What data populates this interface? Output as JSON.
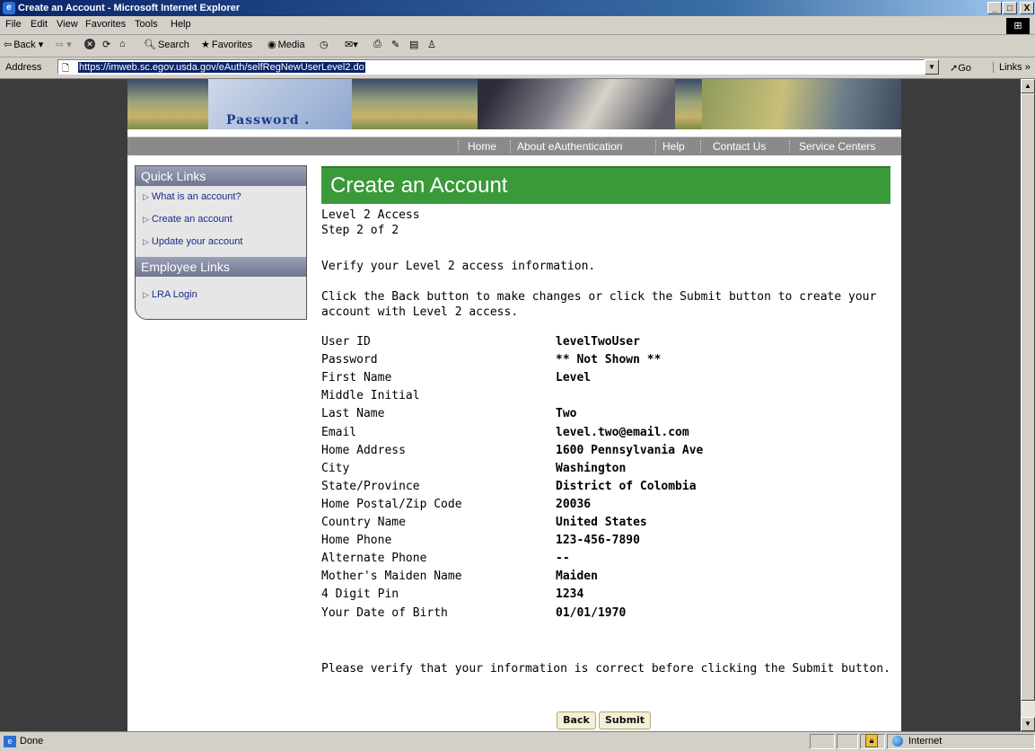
{
  "window": {
    "title": "Create an Account - Microsoft Internet Explorer",
    "minimize": "_",
    "maximize": "□",
    "close": "X"
  },
  "menubar": [
    "File",
    "Edit",
    "View",
    "Favorites",
    "Tools",
    "Help"
  ],
  "toolbar": {
    "back": "Back",
    "search": "Search",
    "favorites": "Favorites",
    "media": "Media"
  },
  "address": {
    "label": "Address",
    "url": "https://imweb.sc.egov.usda.gov/eAuth/selfRegNewUserLevel2.do",
    "go": "Go",
    "links": "Links"
  },
  "banner": {
    "image_text": "Password ."
  },
  "nav": [
    "Home",
    "About eAuthentication",
    "Help",
    "Contact Us",
    "Service Centers"
  ],
  "sidebar": {
    "quick_links_title": "Quick Links",
    "quick_links": [
      "What is an account?",
      "Create an account",
      "Update your account"
    ],
    "employee_links_title": "Employee Links",
    "employee_links": [
      "LRA Login"
    ]
  },
  "main": {
    "title": "Create an Account",
    "level": "Level 2 Access",
    "step": "Step 2 of 2",
    "verify_prompt": "Verify your Level 2 access information.",
    "instructions_line1": "Click the Back button to make changes or click the Submit button to create your",
    "instructions_line2": "account with Level 2 access.",
    "fields": [
      {
        "label": "User ID",
        "value": "levelTwoUser"
      },
      {
        "label": "Password",
        "value": "** Not Shown **"
      },
      {
        "label": "First Name",
        "value": "Level"
      },
      {
        "label": "Middle Initial",
        "value": ""
      },
      {
        "label": "Last Name",
        "value": "Two"
      },
      {
        "label": "Email",
        "value": "level.two@email.com"
      },
      {
        "label": "Home Address",
        "value": "1600 Pennsylvania Ave"
      },
      {
        "label": "City",
        "value": "Washington"
      },
      {
        "label": "State/Province",
        "value": "District of Colombia"
      },
      {
        "label": "Home Postal/Zip Code",
        "value": "20036"
      },
      {
        "label": "Country Name",
        "value": "United States"
      },
      {
        "label": "Home Phone",
        "value": "123-456-7890"
      },
      {
        "label": "Alternate Phone",
        "value": "--"
      },
      {
        "label": "Mother's Maiden Name",
        "value": "Maiden"
      },
      {
        "label": "4 Digit Pin",
        "value": "1234"
      },
      {
        "label": "Your Date of Birth",
        "value": "01/01/1970"
      }
    ],
    "footer_note": "Please verify that your information is correct before clicking the Submit button.",
    "back_button": "Back",
    "submit_button": "Submit"
  },
  "status": {
    "text": "Done",
    "zone": "Internet"
  },
  "colors": {
    "title_green": "#3a9a3a",
    "nav_gray": "#8a8a8a",
    "titlebar_blue": "#0a246a"
  }
}
